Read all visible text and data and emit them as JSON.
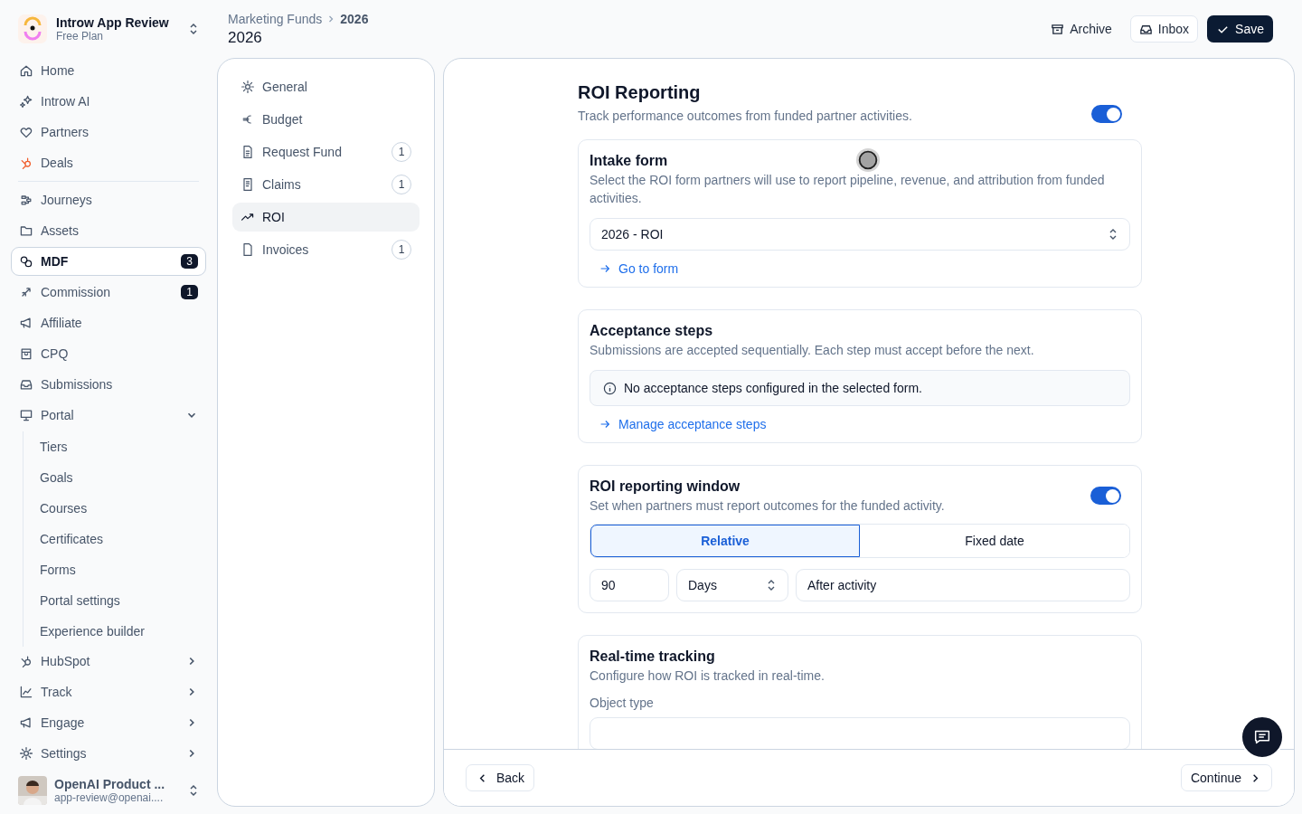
{
  "workspace": {
    "name": "Introw App Review",
    "plan": "Free Plan"
  },
  "nav": {
    "primary": [
      {
        "label": "Home",
        "selected": false
      },
      {
        "label": "Introw AI",
        "selected": false
      },
      {
        "label": "Partners",
        "selected": false
      },
      {
        "label": "Deals",
        "selected": false
      }
    ],
    "secondary": [
      {
        "label": "Journeys",
        "selected": false
      },
      {
        "label": "Assets",
        "selected": false
      },
      {
        "label": "MDF",
        "selected": true,
        "badge": "3"
      },
      {
        "label": "Commission",
        "selected": false,
        "badge": "1"
      },
      {
        "label": "Affiliate",
        "selected": false
      },
      {
        "label": "CPQ",
        "selected": false
      },
      {
        "label": "Submissions",
        "selected": false
      },
      {
        "label": "Portal",
        "selected": false,
        "expanded": true,
        "children": [
          {
            "label": "Tiers"
          },
          {
            "label": "Goals"
          },
          {
            "label": "Courses"
          },
          {
            "label": "Certificates"
          },
          {
            "label": "Forms"
          },
          {
            "label": "Portal settings"
          },
          {
            "label": "Experience builder"
          }
        ]
      },
      {
        "label": "HubSpot",
        "selected": false,
        "expanded": false
      },
      {
        "label": "Track",
        "selected": false,
        "expanded": false
      },
      {
        "label": "Engage",
        "selected": false,
        "expanded": false
      },
      {
        "label": "Settings",
        "selected": false,
        "expanded": false
      }
    ]
  },
  "user": {
    "name": "OpenAI Product ...",
    "email": "app-review@openai...."
  },
  "breadcrumb": {
    "parent": "Marketing Funds",
    "current": "2026"
  },
  "page_title": "2026",
  "actions": [
    {
      "label": "Archive",
      "kind": "ghost"
    },
    {
      "label": "Inbox",
      "kind": "outline"
    },
    {
      "label": "Save",
      "kind": "primary"
    }
  ],
  "subnav": [
    {
      "label": "General",
      "selected": false
    },
    {
      "label": "Budget",
      "selected": false
    },
    {
      "label": "Request Fund",
      "selected": false,
      "count": "1"
    },
    {
      "label": "Claims",
      "selected": false,
      "count": "1"
    },
    {
      "label": "ROI",
      "selected": true
    },
    {
      "label": "Invoices",
      "selected": false,
      "count": "1"
    }
  ],
  "section": {
    "title": "ROI Reporting",
    "description": "Track performance outcomes from funded partner activities.",
    "on": true
  },
  "cards": [
    {
      "kind": "select",
      "title": "Intake form",
      "description": "Select the ROI form partners will use to report pipeline, revenue, and attribution from funded activities.",
      "value": "2026 - ROI",
      "link": "Go to form"
    },
    {
      "kind": "notice",
      "title": "Acceptance steps",
      "description": "Submissions are accepted sequentially. Each step must accept before the next.",
      "notice": "No acceptance steps configured in the selected form.",
      "link": "Manage acceptance steps"
    },
    {
      "kind": "window",
      "title": "ROI reporting window",
      "description": "Set when partners must report outcomes for the funded activity.",
      "on": true,
      "segments": [
        {
          "label": "Relative",
          "selected": true
        },
        {
          "label": "Fixed date",
          "selected": false
        }
      ],
      "amount": "90",
      "unit": "Days",
      "anchor": "After activity"
    },
    {
      "kind": "tracking",
      "title": "Real-time tracking",
      "description": "Configure how ROI is tracked in real-time.",
      "field_label": "Object type"
    }
  ],
  "footer": {
    "back": "Back",
    "continue": "Continue"
  }
}
